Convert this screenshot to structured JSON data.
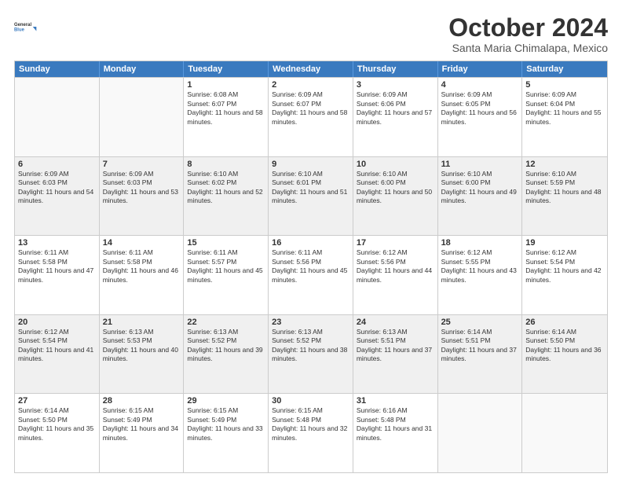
{
  "header": {
    "logo_line1": "General",
    "logo_line2": "Blue",
    "month_title": "October 2024",
    "location": "Santa Maria Chimalapa, Mexico"
  },
  "weekdays": [
    "Sunday",
    "Monday",
    "Tuesday",
    "Wednesday",
    "Thursday",
    "Friday",
    "Saturday"
  ],
  "weeks": [
    [
      {
        "day": "",
        "sunrise": "",
        "sunset": "",
        "daylight": "",
        "empty": true
      },
      {
        "day": "",
        "sunrise": "",
        "sunset": "",
        "daylight": "",
        "empty": true
      },
      {
        "day": "1",
        "sunrise": "Sunrise: 6:08 AM",
        "sunset": "Sunset: 6:07 PM",
        "daylight": "Daylight: 11 hours and 58 minutes."
      },
      {
        "day": "2",
        "sunrise": "Sunrise: 6:09 AM",
        "sunset": "Sunset: 6:07 PM",
        "daylight": "Daylight: 11 hours and 58 minutes."
      },
      {
        "day": "3",
        "sunrise": "Sunrise: 6:09 AM",
        "sunset": "Sunset: 6:06 PM",
        "daylight": "Daylight: 11 hours and 57 minutes."
      },
      {
        "day": "4",
        "sunrise": "Sunrise: 6:09 AM",
        "sunset": "Sunset: 6:05 PM",
        "daylight": "Daylight: 11 hours and 56 minutes."
      },
      {
        "day": "5",
        "sunrise": "Sunrise: 6:09 AM",
        "sunset": "Sunset: 6:04 PM",
        "daylight": "Daylight: 11 hours and 55 minutes."
      }
    ],
    [
      {
        "day": "6",
        "sunrise": "Sunrise: 6:09 AM",
        "sunset": "Sunset: 6:03 PM",
        "daylight": "Daylight: 11 hours and 54 minutes."
      },
      {
        "day": "7",
        "sunrise": "Sunrise: 6:09 AM",
        "sunset": "Sunset: 6:03 PM",
        "daylight": "Daylight: 11 hours and 53 minutes."
      },
      {
        "day": "8",
        "sunrise": "Sunrise: 6:10 AM",
        "sunset": "Sunset: 6:02 PM",
        "daylight": "Daylight: 11 hours and 52 minutes."
      },
      {
        "day": "9",
        "sunrise": "Sunrise: 6:10 AM",
        "sunset": "Sunset: 6:01 PM",
        "daylight": "Daylight: 11 hours and 51 minutes."
      },
      {
        "day": "10",
        "sunrise": "Sunrise: 6:10 AM",
        "sunset": "Sunset: 6:00 PM",
        "daylight": "Daylight: 11 hours and 50 minutes."
      },
      {
        "day": "11",
        "sunrise": "Sunrise: 6:10 AM",
        "sunset": "Sunset: 6:00 PM",
        "daylight": "Daylight: 11 hours and 49 minutes."
      },
      {
        "day": "12",
        "sunrise": "Sunrise: 6:10 AM",
        "sunset": "Sunset: 5:59 PM",
        "daylight": "Daylight: 11 hours and 48 minutes."
      }
    ],
    [
      {
        "day": "13",
        "sunrise": "Sunrise: 6:11 AM",
        "sunset": "Sunset: 5:58 PM",
        "daylight": "Daylight: 11 hours and 47 minutes."
      },
      {
        "day": "14",
        "sunrise": "Sunrise: 6:11 AM",
        "sunset": "Sunset: 5:58 PM",
        "daylight": "Daylight: 11 hours and 46 minutes."
      },
      {
        "day": "15",
        "sunrise": "Sunrise: 6:11 AM",
        "sunset": "Sunset: 5:57 PM",
        "daylight": "Daylight: 11 hours and 45 minutes."
      },
      {
        "day": "16",
        "sunrise": "Sunrise: 6:11 AM",
        "sunset": "Sunset: 5:56 PM",
        "daylight": "Daylight: 11 hours and 45 minutes."
      },
      {
        "day": "17",
        "sunrise": "Sunrise: 6:12 AM",
        "sunset": "Sunset: 5:56 PM",
        "daylight": "Daylight: 11 hours and 44 minutes."
      },
      {
        "day": "18",
        "sunrise": "Sunrise: 6:12 AM",
        "sunset": "Sunset: 5:55 PM",
        "daylight": "Daylight: 11 hours and 43 minutes."
      },
      {
        "day": "19",
        "sunrise": "Sunrise: 6:12 AM",
        "sunset": "Sunset: 5:54 PM",
        "daylight": "Daylight: 11 hours and 42 minutes."
      }
    ],
    [
      {
        "day": "20",
        "sunrise": "Sunrise: 6:12 AM",
        "sunset": "Sunset: 5:54 PM",
        "daylight": "Daylight: 11 hours and 41 minutes."
      },
      {
        "day": "21",
        "sunrise": "Sunrise: 6:13 AM",
        "sunset": "Sunset: 5:53 PM",
        "daylight": "Daylight: 11 hours and 40 minutes."
      },
      {
        "day": "22",
        "sunrise": "Sunrise: 6:13 AM",
        "sunset": "Sunset: 5:52 PM",
        "daylight": "Daylight: 11 hours and 39 minutes."
      },
      {
        "day": "23",
        "sunrise": "Sunrise: 6:13 AM",
        "sunset": "Sunset: 5:52 PM",
        "daylight": "Daylight: 11 hours and 38 minutes."
      },
      {
        "day": "24",
        "sunrise": "Sunrise: 6:13 AM",
        "sunset": "Sunset: 5:51 PM",
        "daylight": "Daylight: 11 hours and 37 minutes."
      },
      {
        "day": "25",
        "sunrise": "Sunrise: 6:14 AM",
        "sunset": "Sunset: 5:51 PM",
        "daylight": "Daylight: 11 hours and 37 minutes."
      },
      {
        "day": "26",
        "sunrise": "Sunrise: 6:14 AM",
        "sunset": "Sunset: 5:50 PM",
        "daylight": "Daylight: 11 hours and 36 minutes."
      }
    ],
    [
      {
        "day": "27",
        "sunrise": "Sunrise: 6:14 AM",
        "sunset": "Sunset: 5:50 PM",
        "daylight": "Daylight: 11 hours and 35 minutes."
      },
      {
        "day": "28",
        "sunrise": "Sunrise: 6:15 AM",
        "sunset": "Sunset: 5:49 PM",
        "daylight": "Daylight: 11 hours and 34 minutes."
      },
      {
        "day": "29",
        "sunrise": "Sunrise: 6:15 AM",
        "sunset": "Sunset: 5:49 PM",
        "daylight": "Daylight: 11 hours and 33 minutes."
      },
      {
        "day": "30",
        "sunrise": "Sunrise: 6:15 AM",
        "sunset": "Sunset: 5:48 PM",
        "daylight": "Daylight: 11 hours and 32 minutes."
      },
      {
        "day": "31",
        "sunrise": "Sunrise: 6:16 AM",
        "sunset": "Sunset: 5:48 PM",
        "daylight": "Daylight: 11 hours and 31 minutes."
      },
      {
        "day": "",
        "sunrise": "",
        "sunset": "",
        "daylight": "",
        "empty": true
      },
      {
        "day": "",
        "sunrise": "",
        "sunset": "",
        "daylight": "",
        "empty": true
      }
    ]
  ]
}
